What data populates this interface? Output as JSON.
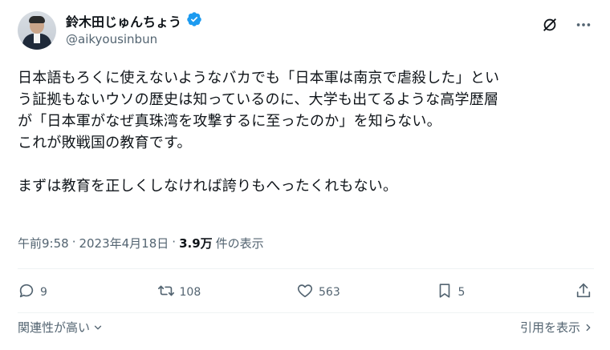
{
  "author": {
    "display_name": "鈴木田じゅんちょう",
    "handle": "@aikyousinbun",
    "verified": true,
    "verified_color": "#1d9bf0"
  },
  "tweet": {
    "text": "日本語もろくに使えないようなバカでも「日本軍は南京で虐殺した」とい\nう証拠もないウソの歴史は知っているのに、大学も出てるような高学歴層\nが「日本軍がなぜ真珠湾を攻撃するに至ったのか」を知らない。\nこれが敗戦国の教育です。\n\nまずは教育を正しくしなければ誇りもへったくれもない。"
  },
  "meta": {
    "time": "午前9:58",
    "sep1": "·",
    "date": "2023年4月18日",
    "sep2": "·",
    "views": "3.9万",
    "views_label": "件の表示"
  },
  "actions": {
    "replies": "9",
    "retweets": "108",
    "likes": "563",
    "bookmarks": "5"
  },
  "footer": {
    "sort_label": "関連性が高い",
    "quote_label": "引用を表示"
  },
  "icons": {
    "grok": "grok-icon",
    "more": "more-icon",
    "reply": "reply-icon",
    "retweet": "retweet-icon",
    "like": "like-icon",
    "bookmark": "bookmark-icon",
    "share": "share-icon"
  }
}
